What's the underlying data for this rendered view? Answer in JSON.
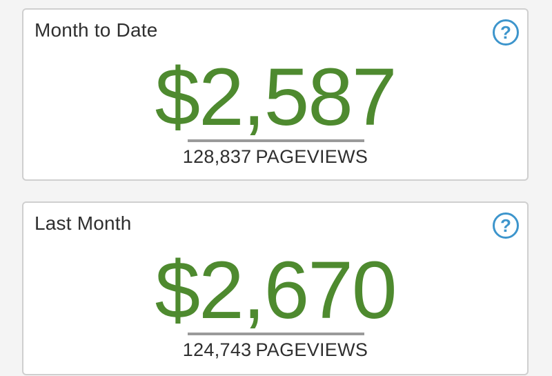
{
  "cards": [
    {
      "title": "Month to Date",
      "amount": "$2,587",
      "pageviews_count": "128,837",
      "pageviews_label": "PAGEVIEWS",
      "help_icon": "help-circle-icon",
      "help_glyph": "?"
    },
    {
      "title": "Last Month",
      "amount": "$2,670",
      "pageviews_count": "124,743",
      "pageviews_label": "PAGEVIEWS",
      "help_icon": "help-circle-icon",
      "help_glyph": "?"
    }
  ],
  "colors": {
    "amount": "#4e8a2f",
    "help_icon": "#3d95cc",
    "text": "#2f2f2f",
    "card_border": "#cfcfcf",
    "background": "#f4f4f4"
  }
}
